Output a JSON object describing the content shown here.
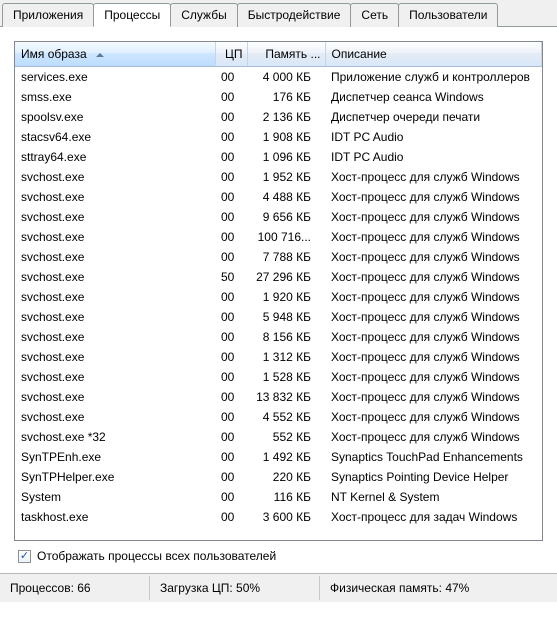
{
  "tabs": [
    {
      "label": "Приложения",
      "active": false
    },
    {
      "label": "Процессы",
      "active": true
    },
    {
      "label": "Службы",
      "active": false
    },
    {
      "label": "Быстродействие",
      "active": false
    },
    {
      "label": "Сеть",
      "active": false
    },
    {
      "label": "Пользователи",
      "active": false
    }
  ],
  "columns": {
    "name": "Имя образа",
    "cpu": "ЦП",
    "memory": "Память ...",
    "description": "Описание"
  },
  "processes": [
    {
      "name": "services.exe",
      "cpu": "00",
      "mem": "4 000 КБ",
      "desc": "Приложение служб и контроллеров"
    },
    {
      "name": "smss.exe",
      "cpu": "00",
      "mem": "176 КБ",
      "desc": "Диспетчер сеанса  Windows"
    },
    {
      "name": "spoolsv.exe",
      "cpu": "00",
      "mem": "2 136 КБ",
      "desc": "Диспетчер очереди печати"
    },
    {
      "name": "stacsv64.exe",
      "cpu": "00",
      "mem": "1 908 КБ",
      "desc": "IDT PC Audio"
    },
    {
      "name": "sttray64.exe",
      "cpu": "00",
      "mem": "1 096 КБ",
      "desc": "IDT PC Audio"
    },
    {
      "name": "svchost.exe",
      "cpu": "00",
      "mem": "1 952 КБ",
      "desc": "Хост-процесс для служб Windows"
    },
    {
      "name": "svchost.exe",
      "cpu": "00",
      "mem": "4 488 КБ",
      "desc": "Хост-процесс для служб Windows"
    },
    {
      "name": "svchost.exe",
      "cpu": "00",
      "mem": "9 656 КБ",
      "desc": "Хост-процесс для служб Windows"
    },
    {
      "name": "svchost.exe",
      "cpu": "00",
      "mem": "100 716...",
      "desc": "Хост-процесс для служб Windows"
    },
    {
      "name": "svchost.exe",
      "cpu": "00",
      "mem": "7 788 КБ",
      "desc": "Хост-процесс для служб Windows"
    },
    {
      "name": "svchost.exe",
      "cpu": "50",
      "mem": "27 296 КБ",
      "desc": "Хост-процесс для служб Windows"
    },
    {
      "name": "svchost.exe",
      "cpu": "00",
      "mem": "1 920 КБ",
      "desc": "Хост-процесс для служб Windows"
    },
    {
      "name": "svchost.exe",
      "cpu": "00",
      "mem": "5 948 КБ",
      "desc": "Хост-процесс для служб Windows"
    },
    {
      "name": "svchost.exe",
      "cpu": "00",
      "mem": "8 156 КБ",
      "desc": "Хост-процесс для служб Windows"
    },
    {
      "name": "svchost.exe",
      "cpu": "00",
      "mem": "1 312 КБ",
      "desc": "Хост-процесс для служб Windows"
    },
    {
      "name": "svchost.exe",
      "cpu": "00",
      "mem": "1 528 КБ",
      "desc": "Хост-процесс для служб Windows"
    },
    {
      "name": "svchost.exe",
      "cpu": "00",
      "mem": "13 832 КБ",
      "desc": "Хост-процесс для служб Windows"
    },
    {
      "name": "svchost.exe",
      "cpu": "00",
      "mem": "4 552 КБ",
      "desc": "Хост-процесс для служб Windows"
    },
    {
      "name": "svchost.exe *32",
      "cpu": "00",
      "mem": "552 КБ",
      "desc": "Хост-процесс для служб Windows"
    },
    {
      "name": "SynTPEnh.exe",
      "cpu": "00",
      "mem": "1 492 КБ",
      "desc": "Synaptics TouchPad Enhancements"
    },
    {
      "name": "SynTPHelper.exe",
      "cpu": "00",
      "mem": "220 КБ",
      "desc": "Synaptics Pointing Device Helper"
    },
    {
      "name": "System",
      "cpu": "00",
      "mem": "116 КБ",
      "desc": "NT Kernel & System"
    },
    {
      "name": "taskhost.exe",
      "cpu": "00",
      "mem": "3 600 КБ",
      "desc": "Хост-процесс для задач Windows"
    }
  ],
  "show_all_users": {
    "checked": true,
    "label": "Отображать процессы всех пользователей"
  },
  "status": {
    "processes": "Процессов: 66",
    "cpu": "Загрузка ЦП: 50%",
    "memory": "Физическая память: 47%"
  }
}
